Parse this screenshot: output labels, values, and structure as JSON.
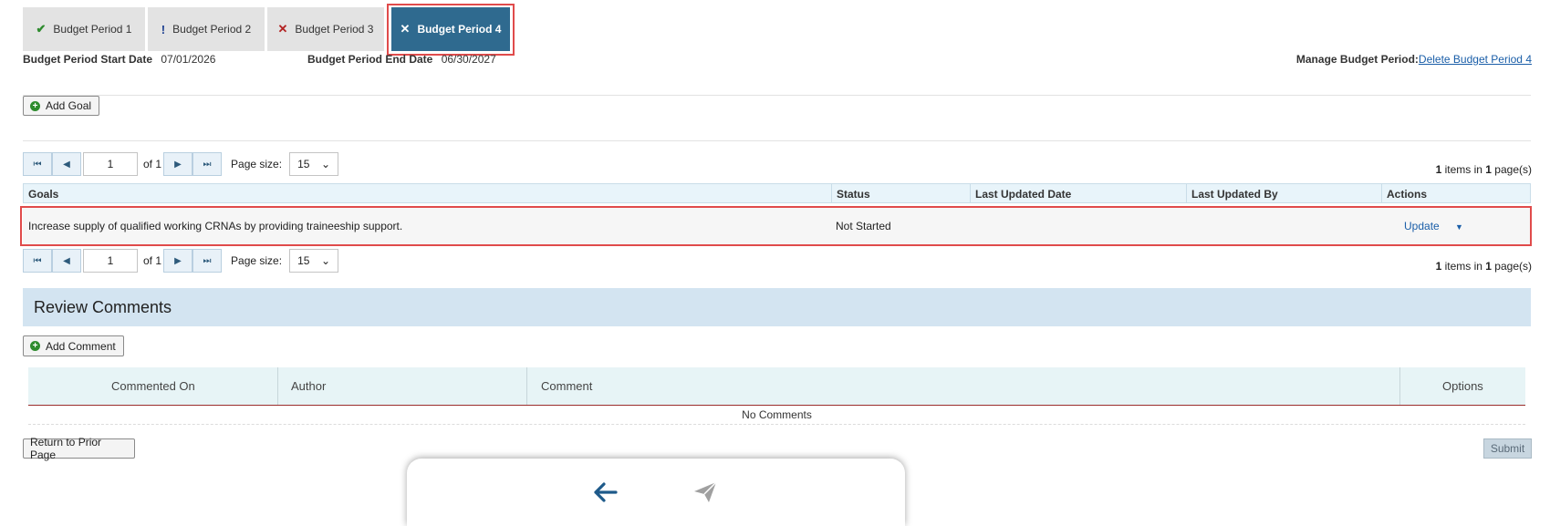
{
  "tabs": [
    {
      "label": "Budget Period 1",
      "icon": "check-icon",
      "icon_color": "#2e8b2e"
    },
    {
      "label": "Budget Period 2",
      "icon": "exclamation-icon",
      "icon_color": "#1a3d8f"
    },
    {
      "label": "Budget Period 3",
      "icon": "x-icon",
      "icon_color": "#b22222"
    },
    {
      "label": "Budget Period 4",
      "icon": "x-icon",
      "active": true
    }
  ],
  "period": {
    "start_label": "Budget Period Start Date",
    "start_value": "07/01/2026",
    "end_label": "Budget Period End Date",
    "end_value": "06/30/2027",
    "manage_label": "Manage Budget Period:",
    "manage_link": "Delete Budget Period 4"
  },
  "goals": {
    "add_label": "Add Goal",
    "pager": {
      "page": "1",
      "of_label": "of 1",
      "page_size_label": "Page size:",
      "page_size": "15",
      "items_count": "1",
      "items_mid": " items in ",
      "pages_count": "1",
      "pages_suffix": " page(s)"
    },
    "columns": [
      "Goals",
      "Status",
      "Last Updated Date",
      "Last Updated By",
      "Actions"
    ],
    "rows": [
      {
        "goal": "Increase supply of qualified working CRNAs by providing traineeship support.",
        "status": "Not Started",
        "last_updated_date": "",
        "last_updated_by": "",
        "action": "Update"
      }
    ]
  },
  "review": {
    "title": "Review Comments",
    "add_label": "Add Comment",
    "columns": [
      "Commented On",
      "Author",
      "Comment",
      "Options"
    ],
    "empty_text": "No Comments"
  },
  "footer": {
    "return_label": "Return to Prior Page",
    "submit_label": "Submit"
  },
  "colors": {
    "active_tab": "#2f6a8f",
    "highlight": "#e04b4b",
    "link": "#1a5ea8",
    "band": "#d3e4f1"
  }
}
